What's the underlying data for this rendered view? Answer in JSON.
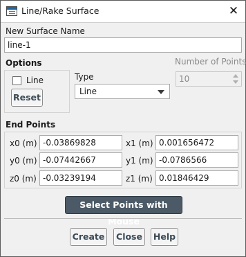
{
  "window": {
    "title": "Line/Rake Surface",
    "close_glyph": "✕"
  },
  "surface_name": {
    "label": "New Surface Name",
    "value": "line-1"
  },
  "options": {
    "label": "Options",
    "line_checkbox_label": "Line",
    "line_checked": false,
    "reset_label": "Reset"
  },
  "type": {
    "label": "Type",
    "selected": "Line"
  },
  "num_points": {
    "label": "Number of Points",
    "value": "10",
    "enabled": false
  },
  "end_points": {
    "label": "End Points",
    "fields": [
      {
        "label": "x0 (m)",
        "value": "-0.03869828"
      },
      {
        "label": "x1 (m)",
        "value": "0.001656472"
      },
      {
        "label": "y0 (m)",
        "value": "-0.07442667"
      },
      {
        "label": "y1 (m)",
        "value": "-0.0786566"
      },
      {
        "label": "z0 (m)",
        "value": "-0.03239194"
      },
      {
        "label": "z1 (m)",
        "value": "0.01846429"
      }
    ]
  },
  "select_points_label": "Select Points with Mouse",
  "footer": {
    "create_label": "Create",
    "close_label": "Close",
    "help_label": "Help"
  },
  "icons": {
    "app": "surface-app-icon",
    "close": "close-icon",
    "dropdown": "chevron-down-icon",
    "spinner": "spinner-arrows-icon"
  },
  "colors": {
    "primary_button": "#4b5a66",
    "title_icon_blue": "#1d67a6",
    "title_icon_red": "#e04a2a"
  }
}
